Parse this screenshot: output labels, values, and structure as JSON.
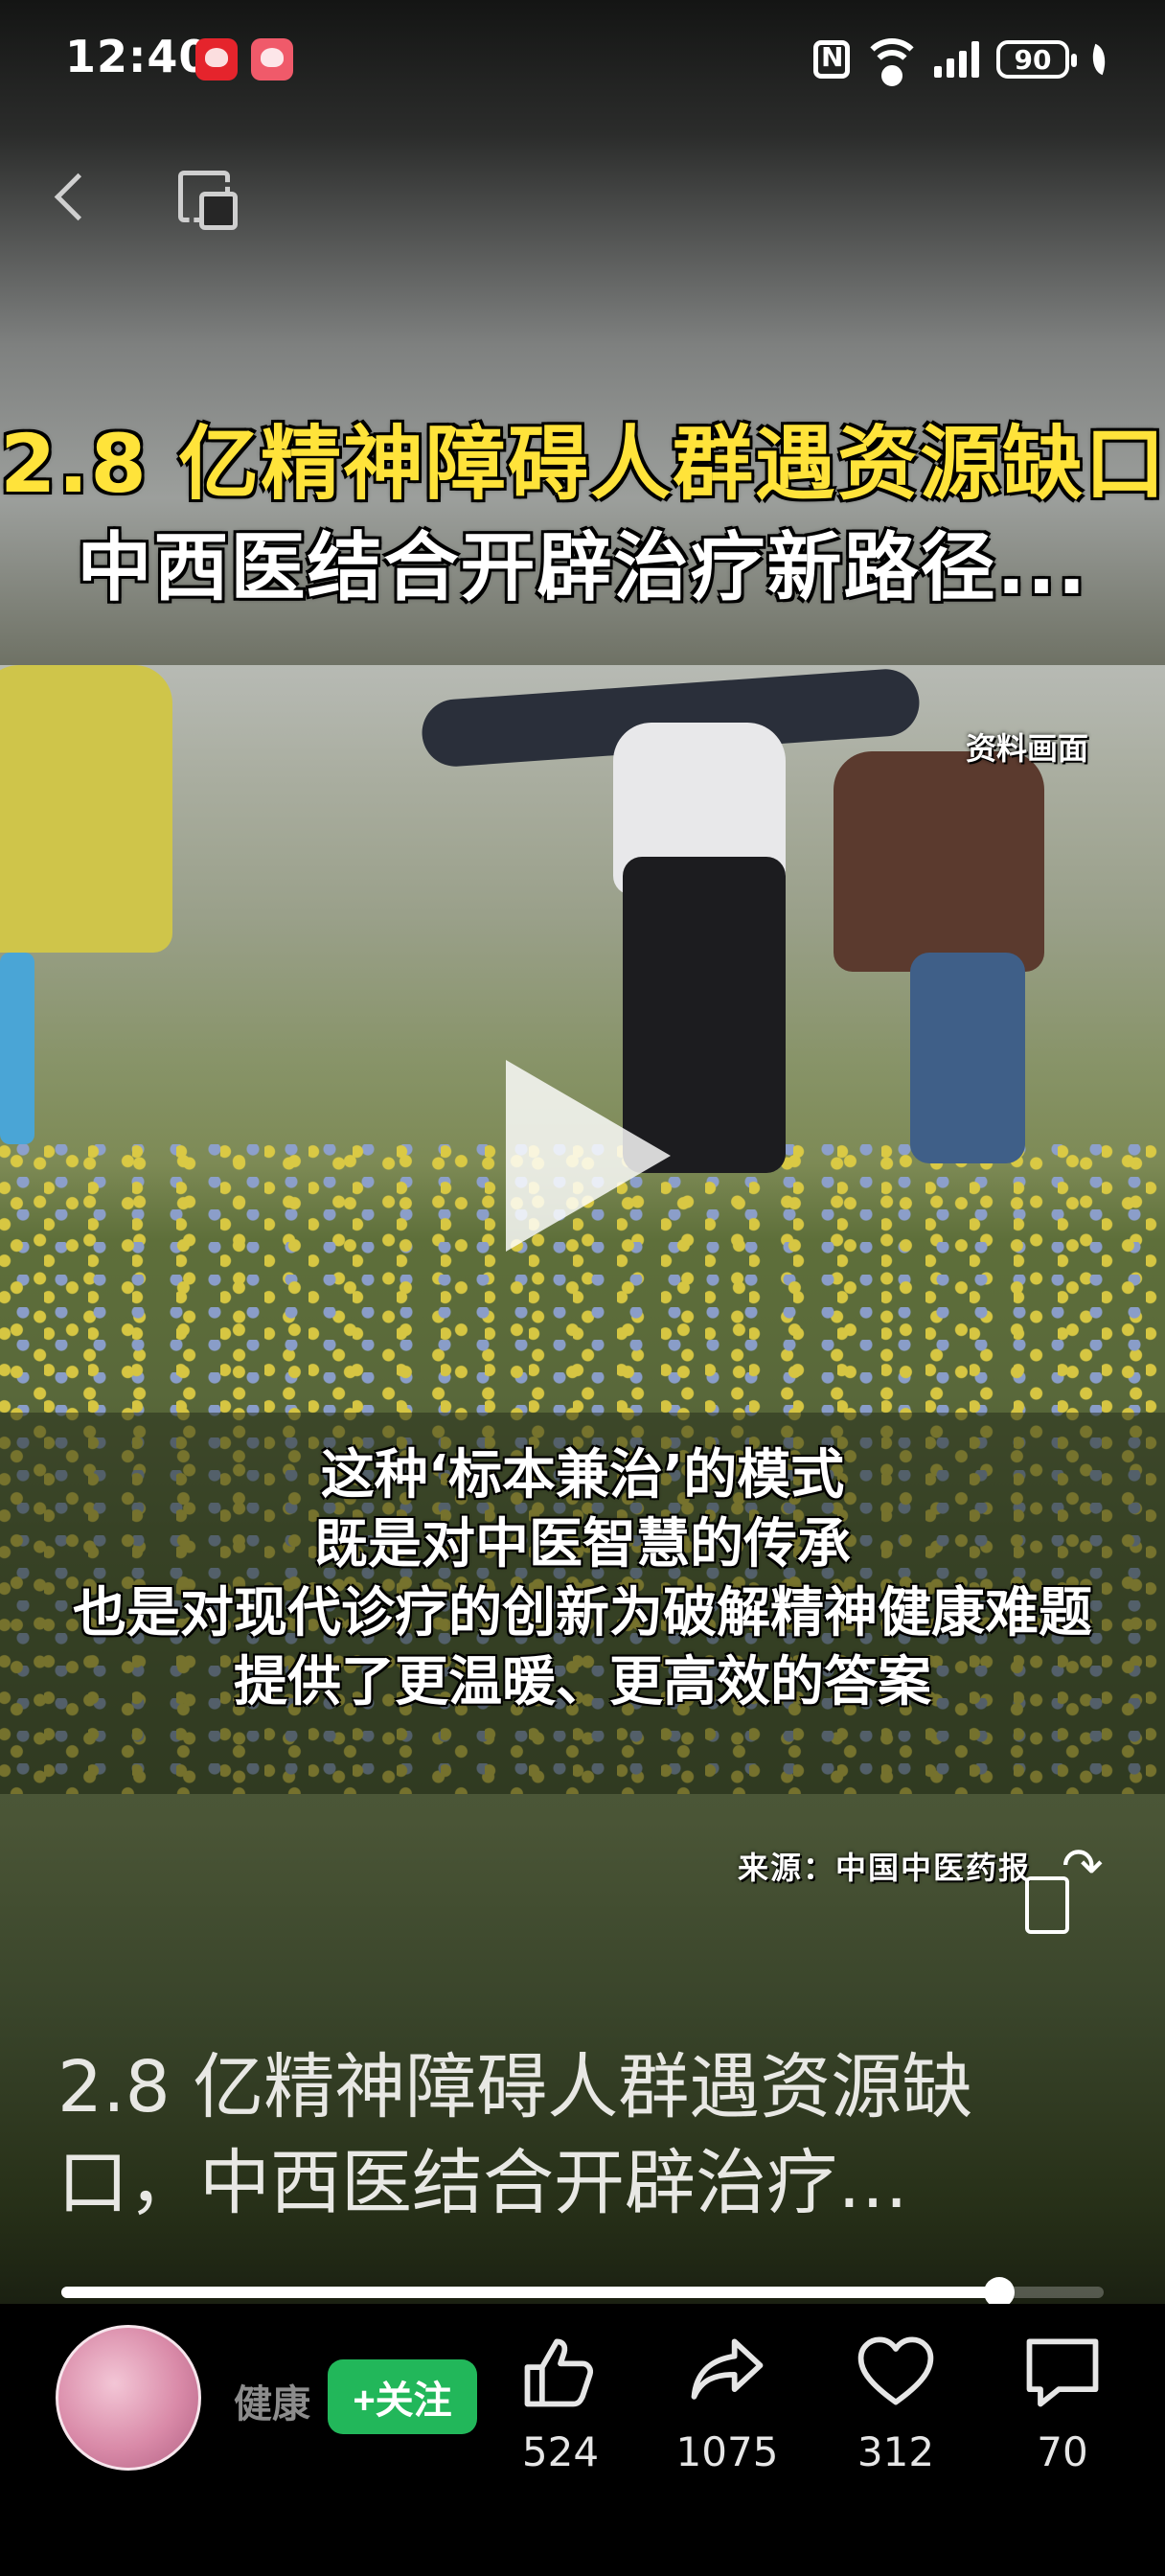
{
  "status_bar": {
    "time": "12:40",
    "battery": "90"
  },
  "video": {
    "headline_line1": "2.8 亿精神障碍人群遇资源缺口",
    "headline_line2": "中西医结合开辟治疗新路径...",
    "footage_tag": "资料画面",
    "subtitles": [
      "这种‘标本兼治’的模式",
      "既是对中医智慧的传承",
      "也是对现代诊疗的创新为破解精神健康难题",
      "提供了更温暖、更高效的答案"
    ],
    "credit": "来源：中国中医药报"
  },
  "post": {
    "title": "2.8 亿精神障碍人群遇资源缺口，中西医结合开辟治疗…",
    "progress_fraction": 0.9
  },
  "author": {
    "name": "健康",
    "follow_label": "+关注"
  },
  "actions": {
    "like_count": "524",
    "share_count": "1075",
    "favorite_count": "312",
    "comment_count": "70"
  },
  "colors": {
    "follow_green": "#22b75a",
    "headline_yellow": "#ffe33a"
  },
  "icons": [
    "back-icon",
    "multi-window-icon",
    "play-icon",
    "rotate-screen-icon",
    "like-icon",
    "share-icon",
    "heart-icon",
    "comment-icon"
  ]
}
